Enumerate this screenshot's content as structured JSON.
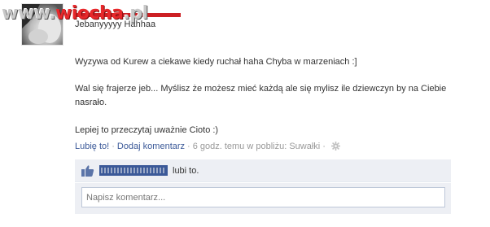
{
  "watermark": {
    "site_prefix": "www.",
    "site_name": "wiocha",
    "site_suffix": ".pl"
  },
  "post": {
    "author": "Jebanyyyyy Hahhaa",
    "messages": [
      "Wyzywa od Kurew a ciekawe kiedy ruchał haha Chyba w marzeniach :]",
      "Wal się frajerze jeb... Myślisz że możesz mieć każdą ale się mylisz ile dziewczyn by na Ciebie nasrało.",
      "Lepiej to przeczytaj uważnie Cioto :)"
    ],
    "actions": {
      "like_label": "Lubię to!",
      "comment_label": "Dodaj komentarz",
      "separator": "·",
      "timestamp": "6 godz. temu w pobliżu: Suwałki"
    }
  },
  "likes": {
    "suffix": "lubi to."
  },
  "comment": {
    "placeholder": "Napisz komentarz..."
  },
  "colors": {
    "link": "#3b5998",
    "meta": "#999999",
    "box_bg": "#edeff4",
    "censor": "#cc1f24"
  },
  "icons": {
    "like": "thumbs-up-icon",
    "gear": "gear-icon"
  }
}
